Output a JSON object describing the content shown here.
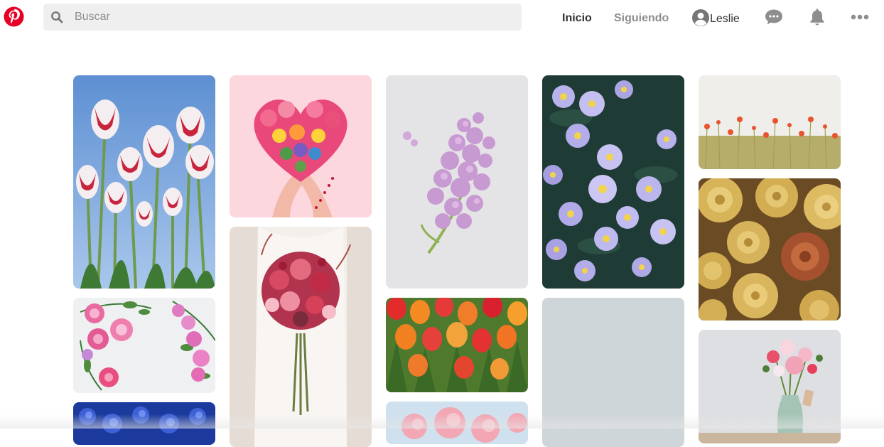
{
  "header": {
    "search": {
      "placeholder": "Buscar",
      "value": ""
    },
    "nav": {
      "home": "Inicio",
      "following": "Siguiendo"
    },
    "user": {
      "name": "Leslie"
    },
    "icons": {
      "logo": "pinterest-logo",
      "search": "search-icon",
      "avatar": "avatar-icon",
      "messages": "chat-bubble-icon",
      "notifications": "bell-icon",
      "more": "more-dots-icon"
    }
  },
  "colors": {
    "brand": "#e60023",
    "nav_active": "#333333",
    "nav_inactive": "#8e8e8e",
    "search_bg": "#efefef",
    "icon_gray": "#8e8e8e"
  },
  "pins": [
    {
      "id": "pin-tulips-red-white",
      "column": 1
    },
    {
      "id": "pin-pink-roses-wreath",
      "column": 1
    },
    {
      "id": "pin-blue-hydrangeas",
      "column": 1
    },
    {
      "id": "pin-flower-heart-hands",
      "column": 2
    },
    {
      "id": "pin-bridal-bouquet",
      "column": 2
    },
    {
      "id": "pin-lilac",
      "column": 3
    },
    {
      "id": "pin-tulip-field",
      "column": 3
    },
    {
      "id": "pin-pink-blossoms",
      "column": 3
    },
    {
      "id": "pin-purple-asters",
      "column": 4
    },
    {
      "id": "pin-gray-placeholder",
      "column": 4
    },
    {
      "id": "pin-poppy-meadow",
      "column": 5
    },
    {
      "id": "pin-golden-roses",
      "column": 5
    },
    {
      "id": "pin-vase-peonies",
      "column": 5
    }
  ]
}
